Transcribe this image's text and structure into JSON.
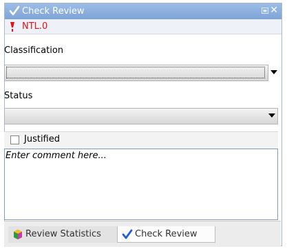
{
  "panel": {
    "title": "Check Review",
    "check_code": "NTL.0"
  },
  "classification": {
    "label": "Classification",
    "value": ""
  },
  "status": {
    "label": "Status",
    "value": ""
  },
  "justified": {
    "label": "Justified",
    "checked": false
  },
  "comment": {
    "placeholder": "Enter comment here..."
  },
  "tabs": [
    {
      "label": "Review Statistics",
      "icon": "review-statistics-icon",
      "active": false
    },
    {
      "label": "Check Review",
      "icon": "check-review-icon",
      "active": true
    }
  ],
  "colors": {
    "titlebar": "#8fb1e0",
    "alert_text": "#e21414",
    "check_blue": "#1f5fd1"
  }
}
